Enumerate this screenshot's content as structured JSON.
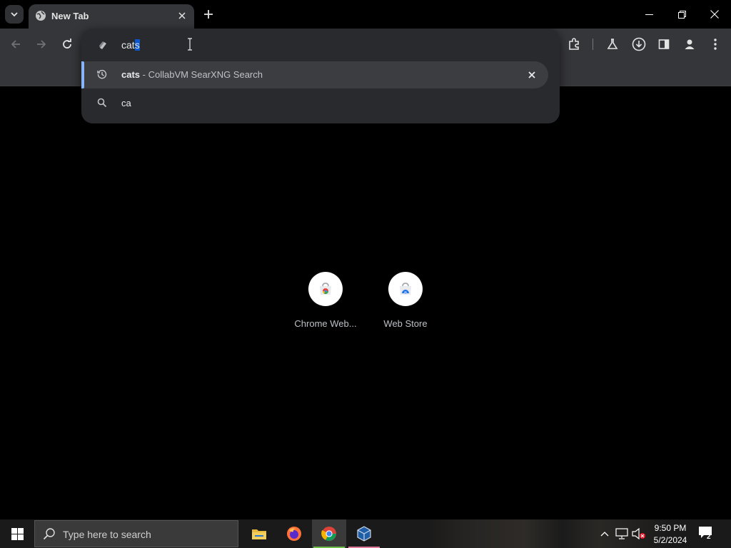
{
  "tab": {
    "title": "New Tab"
  },
  "omnibox": {
    "typed": "cat",
    "selected_completion": "s"
  },
  "suggestions": [
    {
      "query": "cats",
      "separator": " - ",
      "source": "CollabVM SearXNG Search",
      "type": "history"
    },
    {
      "query": "ca",
      "type": "search"
    }
  ],
  "shortcuts": [
    {
      "label": "Chrome Web..."
    },
    {
      "label": "Web Store"
    }
  ],
  "taskbar": {
    "search_placeholder": "Type here to search",
    "time": "9:50 PM",
    "date": "5/2/2024",
    "notification_count": "2"
  },
  "colors": {
    "accent": "#8ab4f8",
    "selection": "#0b57d0",
    "chrome_taskbar_indicator": "#6ec04a",
    "vbox_taskbar_indicator": "#e07a9a"
  },
  "icons": [
    "tab-search-icon",
    "globe-icon",
    "close-icon",
    "plus-icon",
    "minimize-icon",
    "restore-icon",
    "back-icon",
    "forward-icon",
    "reload-icon",
    "extensions-icon",
    "labs-icon",
    "download-icon",
    "side-panel-icon",
    "profile-icon",
    "menu-icon",
    "history-icon",
    "search-icon",
    "windows-icon",
    "file-explorer-icon",
    "firefox-icon",
    "chrome-icon",
    "virtualbox-icon",
    "chevron-up-icon",
    "network-icon",
    "volume-muted-icon",
    "notification-icon"
  ]
}
